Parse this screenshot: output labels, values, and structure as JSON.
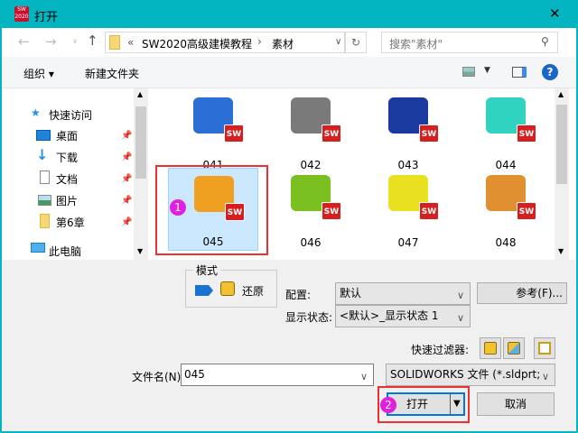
{
  "window": {
    "title": "打开",
    "close": "✕",
    "app_badge": "SW 2020"
  },
  "nav": {
    "path_prefix": "«",
    "path_parent": "SW2020高级建模教程",
    "path_sep": "›",
    "path_current": "素材",
    "search_placeholder": "搜索\"素材\""
  },
  "toolbar": {
    "organize": "组织 ▾",
    "new_folder": "新建文件夹",
    "help": "?"
  },
  "sidebar": {
    "items": [
      {
        "label": "快速访问"
      },
      {
        "label": "桌面"
      },
      {
        "label": "下载"
      },
      {
        "label": "文档"
      },
      {
        "label": "图片"
      },
      {
        "label": "第6章"
      },
      {
        "label": "此电脑"
      }
    ]
  },
  "files": [
    {
      "name": "041",
      "color": "#2a6fd6"
    },
    {
      "name": "042",
      "color": "#7a7a7a"
    },
    {
      "name": "043",
      "color": "#1a3aa0"
    },
    {
      "name": "044",
      "color": "#2fd3c0"
    },
    {
      "name": "045",
      "color": "#f0a020"
    },
    {
      "name": "046",
      "color": "#7ac020"
    },
    {
      "name": "047",
      "color": "#e8e020"
    },
    {
      "name": "048",
      "color": "#e09030"
    }
  ],
  "sw_badge": "SW",
  "annotations": {
    "step1": "1",
    "step2": "2"
  },
  "mode": {
    "legend": "模式",
    "restore": "还原"
  },
  "config": {
    "label": "配置:",
    "value": "默认",
    "reference_button": "参考(F)..."
  },
  "display_state": {
    "label": "显示状态:",
    "value": "<默认>_显示状态 1"
  },
  "quick_filter": {
    "label": "快速过滤器:"
  },
  "filename": {
    "label": "文件名(N):",
    "value": "045"
  },
  "filetype": {
    "value": "SOLIDWORKS 文件 (*.sldprt;"
  },
  "buttons": {
    "open": "打开",
    "cancel": "取消"
  }
}
